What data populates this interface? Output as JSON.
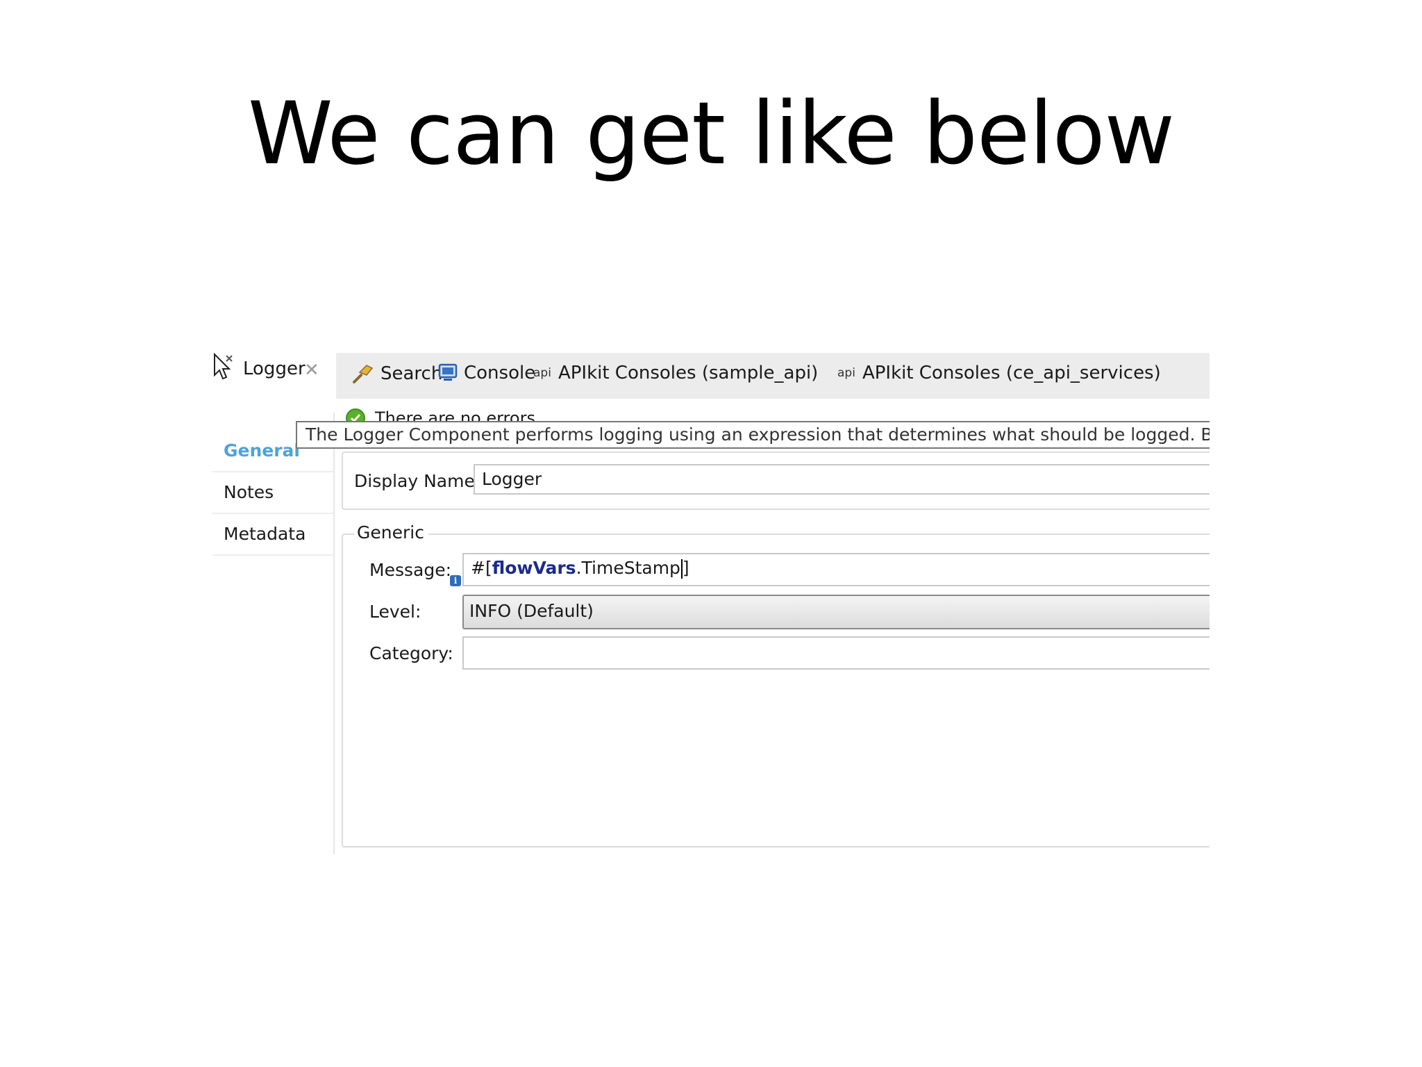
{
  "slide": {
    "title": "We can get like below"
  },
  "editor": {
    "active_tab": {
      "label": "Logger",
      "close_glyph": "✕"
    },
    "tabs": [
      {
        "label": "Search",
        "icon": "search-icon"
      },
      {
        "label": "Console",
        "icon": "console-icon"
      },
      {
        "label": "APIkit Consoles (sample_api)",
        "icon": "api-icon",
        "icon_text": "api"
      },
      {
        "label": "APIkit Consoles (ce_api_services)",
        "icon": "api-icon",
        "icon_text": "api"
      }
    ],
    "status": {
      "text": "There are no errors."
    },
    "tooltip": "The Logger Component performs logging using an expression that determines what should be logged. By default th",
    "nav": [
      {
        "label": "General",
        "active": true
      },
      {
        "label": "Notes"
      },
      {
        "label": "Metadata"
      }
    ],
    "display_name": {
      "label": "Display Name:",
      "value": "Logger"
    },
    "generic": {
      "legend": "Generic",
      "message": {
        "label": "Message:",
        "prefix": "#[",
        "keyword": "flowVars",
        "rest": ".TimeStamp",
        "suffix": "]"
      },
      "level": {
        "label": "Level:",
        "value": "INFO (Default)"
      },
      "category": {
        "label": "Category:",
        "value": ""
      }
    },
    "colors": {
      "accent": "#4fa3d8",
      "keyword": "#1b2a8c",
      "ok": "#5ab030"
    }
  }
}
